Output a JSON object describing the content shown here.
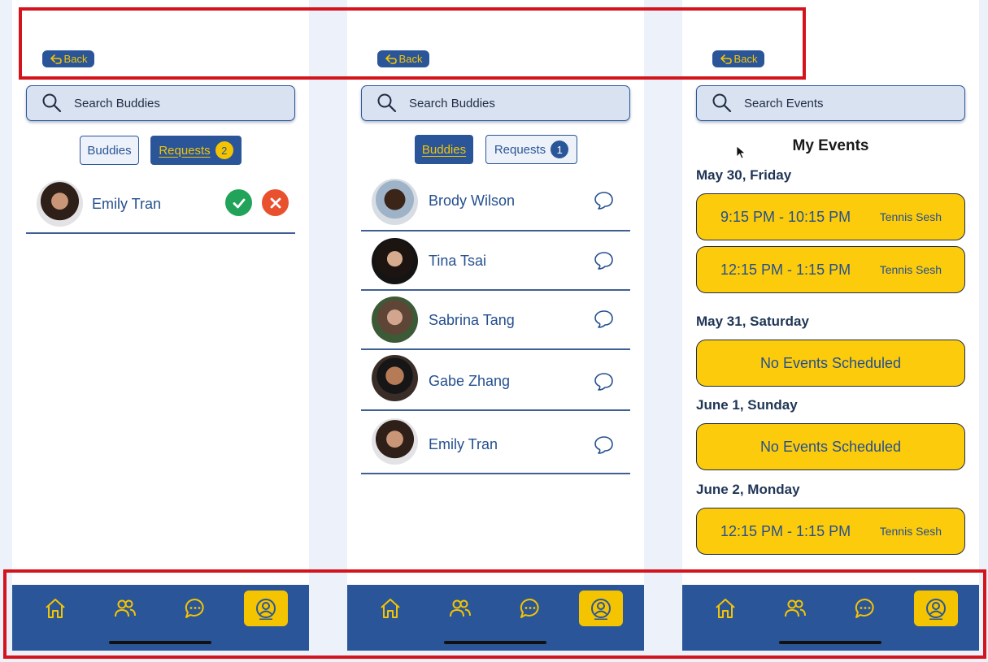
{
  "colors": {
    "primary_blue": "#2a5699",
    "accent_yellow": "#f5c400",
    "event_yellow": "#fccb0b",
    "accept_green": "#22a35a",
    "decline_red": "#e8502e",
    "annotation_red": "#d4141d"
  },
  "back_label": "Back",
  "requests_screen": {
    "search_placeholder": "Search Buddies",
    "tab_buddies": "Buddies",
    "tab_requests": "Requests",
    "requests_badge": "2",
    "requests": [
      {
        "name": "Emily Tran"
      }
    ]
  },
  "buddies_screen": {
    "search_placeholder": "Search Buddies",
    "tab_buddies": "Buddies",
    "tab_requests": "Requests",
    "requests_badge": "1",
    "buddies": [
      {
        "name": "Brody Wilson"
      },
      {
        "name": "Tina Tsai"
      },
      {
        "name": "Sabrina Tang"
      },
      {
        "name": "Gabe Zhang"
      },
      {
        "name": "Emily Tran"
      }
    ]
  },
  "events_screen": {
    "search_placeholder": "Search Events",
    "title": "My Events",
    "days": [
      {
        "date": "May 30, Friday",
        "events": [
          {
            "time": "9:15 PM - 10:15 PM",
            "name": "Tennis Sesh"
          },
          {
            "time": "12:15 PM - 1:15 PM",
            "name": "Tennis Sesh"
          }
        ]
      },
      {
        "date": "May 31, Saturday",
        "empty": "No Events Scheduled"
      },
      {
        "date": "June 1, Sunday",
        "empty": "No Events Scheduled"
      },
      {
        "date": "June 2, Monday",
        "events": [
          {
            "time": "12:15 PM - 1:15 PM",
            "name": "Tennis Sesh"
          }
        ]
      }
    ]
  },
  "nav_icons": [
    "home-icon",
    "people-icon",
    "chat-icon",
    "profile-icon"
  ]
}
